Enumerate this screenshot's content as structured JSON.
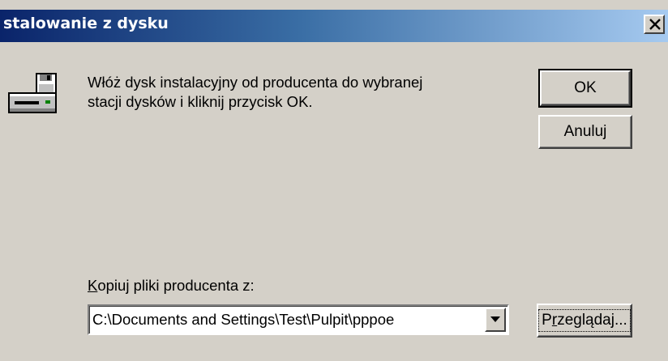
{
  "window": {
    "title": "stalowanie z dysku"
  },
  "icons": {
    "disk": "floppy-disk-drive-icon",
    "close": "close-icon",
    "dropdown": "chevron-down-icon"
  },
  "message": "Włóż dysk instalacyjny od producenta do wybranej\nstacji dysków i kliknij przycisk OK.",
  "buttons": {
    "ok": "OK",
    "cancel": "Anuluj",
    "browse_prefix": "P",
    "browse_accel": "r",
    "browse_suffix": "zeglądaj..."
  },
  "copy_from": {
    "label_accel": "K",
    "label_rest": "opiuj pliki producenta z:",
    "value": "C:\\Documents and Settings\\Test\\Pulpit\\pppoe"
  },
  "colors": {
    "face": "#d4d0c8",
    "title_start": "#0a246a",
    "title_end": "#a6caf0"
  }
}
